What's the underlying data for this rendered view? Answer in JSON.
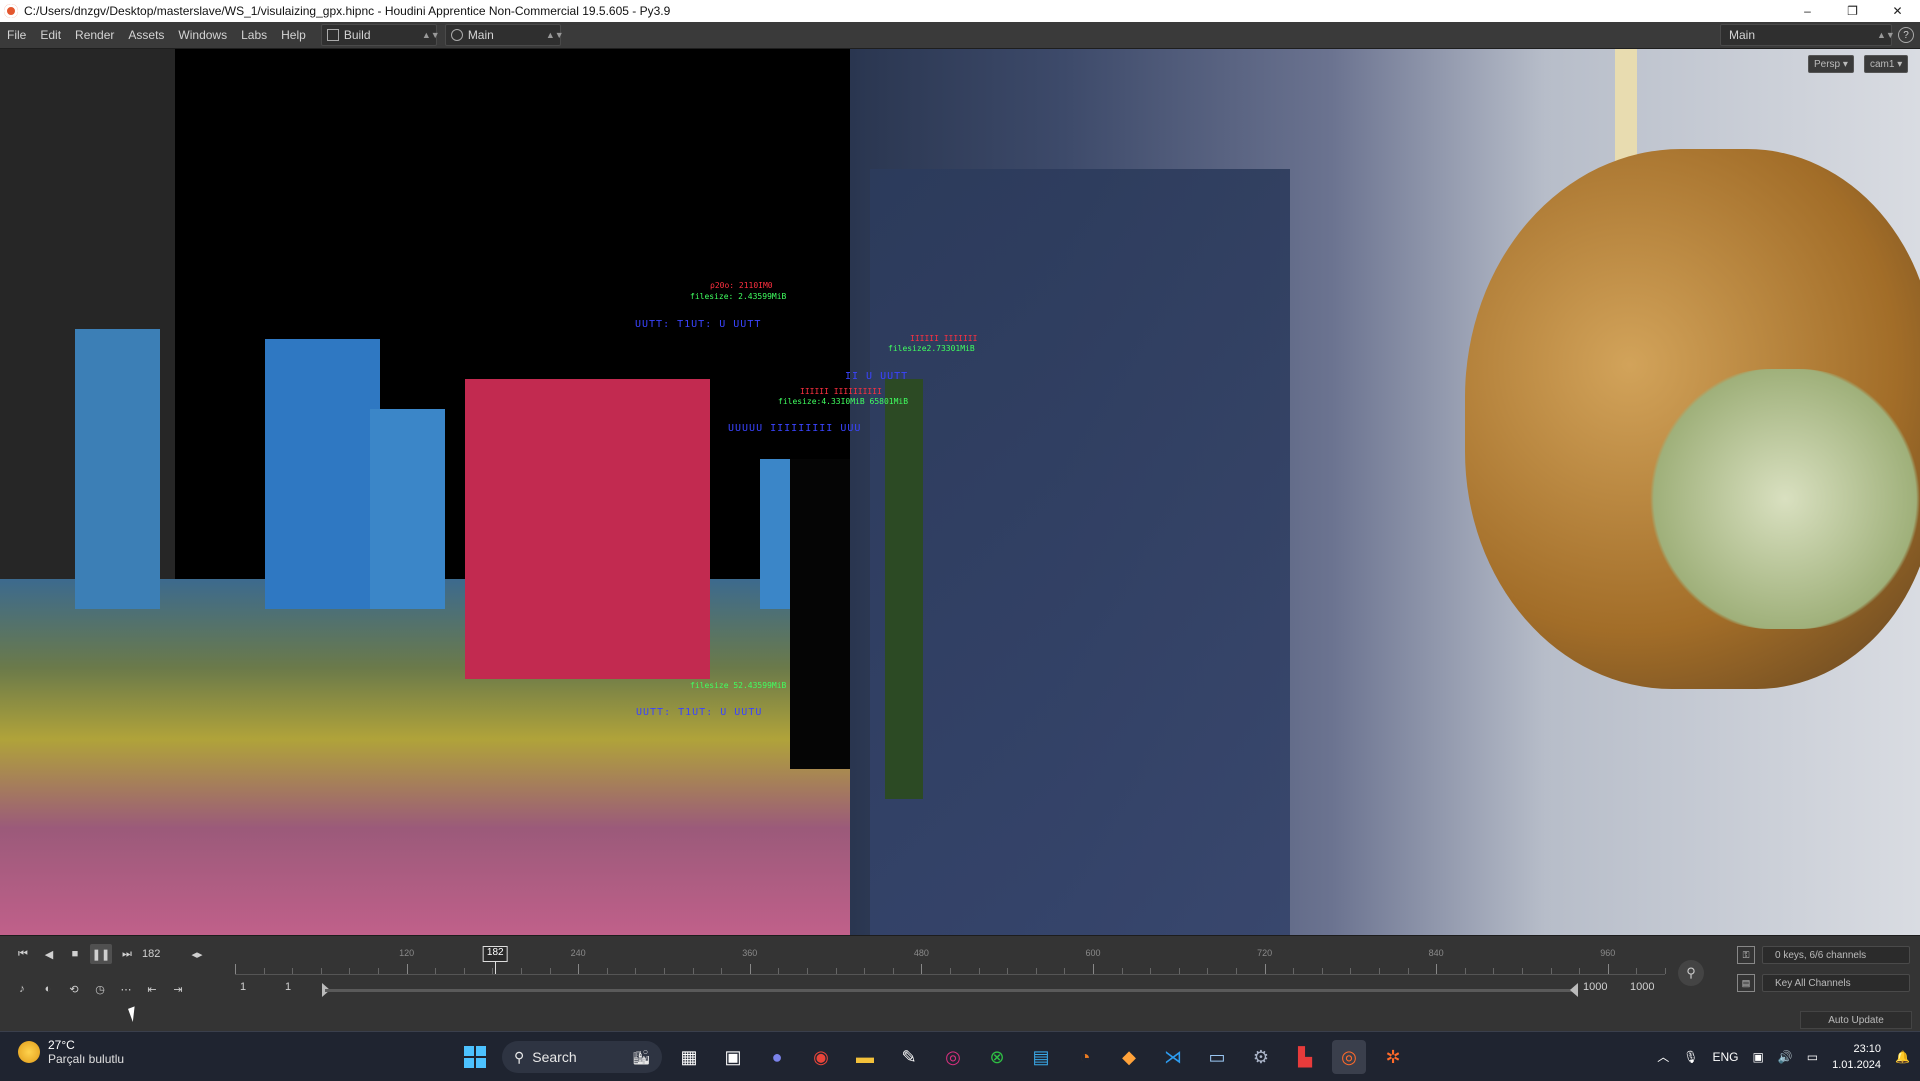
{
  "window": {
    "title": "C:/Users/dnzgv/Desktop/masterslave/WS_1/visulaizing_gpx.hipnc - Houdini Apprentice Non-Commercial 19.5.605 - Py3.9",
    "minimize": "–",
    "maximize": "❐",
    "close": "✕"
  },
  "menubar": {
    "items": [
      "File",
      "Edit",
      "Render",
      "Assets",
      "Windows",
      "Labs",
      "Help"
    ],
    "desktop1": "Build",
    "desktop2": "Main",
    "right_desktop": "Main",
    "help": "?"
  },
  "viewport": {
    "persp": "Persp ▾",
    "cam": "cam1 ▾",
    "labels_red": [
      "ρ20ο: 2110ΙΜ0",
      "ΙΙΙΙΙΙ ΙΙΙΙΙΙΙ",
      "ΙΙΙΙΙΙ ΙΙΙΙΙΙΙΙΙΙ"
    ],
    "labels_green": [
      "filesize: 2.43599MiB",
      "filesize2.73301MiB",
      "filesize:4.33Ι0MiB 65801MiB",
      "filesize 52.43599MiB"
    ],
    "labels_blue": [
      "UUTT: T1UT: U UUTT",
      "ΙΙ U UUTT",
      "UUUUU ΙΙΙΙΙΙΙΙΙ UUU",
      "UUTT: T1UT: U UUTU"
    ]
  },
  "timeline": {
    "current_frame": "182",
    "frame_field": "182",
    "ruler_labels": [
      "120",
      "240",
      "360",
      "480",
      "600",
      "720",
      "840",
      "960"
    ],
    "start1": "1",
    "start2": "1",
    "end1": "1000",
    "end2": "1000",
    "keys_channels": "0 keys, 6/6 channels",
    "key_all": "Key All Channels",
    "auto_update": "Auto Update",
    "progress_fraction": 0.182
  },
  "taskbar": {
    "temp": "27°C",
    "weather_desc": "Parçalı bulutlu",
    "search": "Search",
    "lang": "ENG",
    "time": "23:10",
    "date": "1.01.2024"
  }
}
